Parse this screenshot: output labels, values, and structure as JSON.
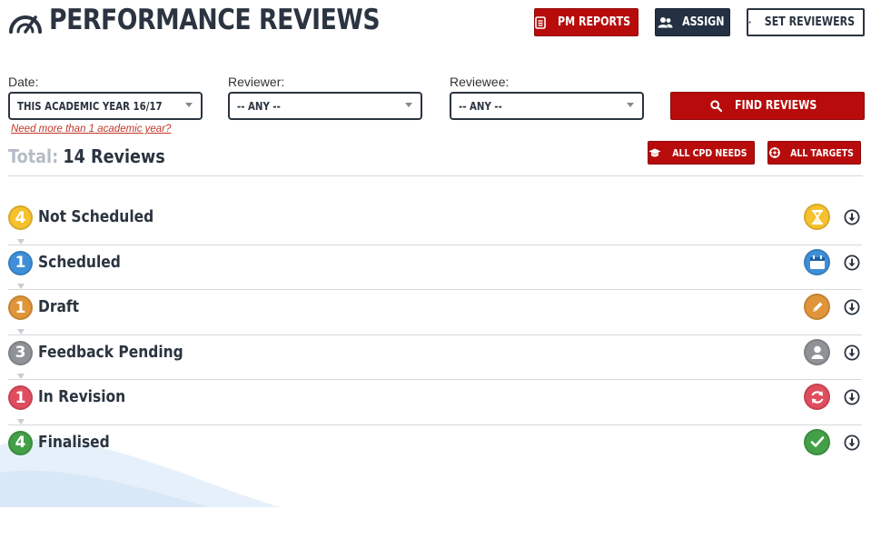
{
  "header": {
    "title": "PERFORMANCE REVIEWS",
    "buttons": {
      "pm_reports": "PM REPORTS",
      "assign": "ASSIGN",
      "set_reviewers": "SET REVIEWERS"
    }
  },
  "filters": {
    "date": {
      "label": "Date:",
      "value": "THIS ACADEMIC YEAR 16/17"
    },
    "reviewer": {
      "label": "Reviewer:",
      "value": "-- ANY --"
    },
    "reviewee": {
      "label": "Reviewee:",
      "value": "-- ANY --"
    },
    "more_years_link": "Need more than 1 academic year?",
    "find_button": "FIND REVIEWS"
  },
  "summary": {
    "total_label": "Total:",
    "total_value": "14 Reviews",
    "cpd_button": "ALL CPD NEEDS",
    "targets_button": "ALL TARGETS"
  },
  "statuses": [
    {
      "count": "4",
      "name": "Not Scheduled",
      "color": "#f5c12e",
      "icon": "hourglass-icon"
    },
    {
      "count": "1",
      "name": "Scheduled",
      "color": "#3f8fd8",
      "icon": "calendar-icon"
    },
    {
      "count": "1",
      "name": "Draft",
      "color": "#e0953a",
      "icon": "pencil-icon"
    },
    {
      "count": "3",
      "name": "Feedback Pending",
      "color": "#8f9297",
      "icon": "person-icon"
    },
    {
      "count": "1",
      "name": "In Revision",
      "color": "#e04d5e",
      "icon": "refresh-icon"
    },
    {
      "count": "4",
      "name": "Finalised",
      "color": "#43a047",
      "icon": "checkmark-icon"
    }
  ],
  "colors": {
    "brand_red": "#b80c0c",
    "navy": "#233143",
    "text": "#2b3440"
  }
}
